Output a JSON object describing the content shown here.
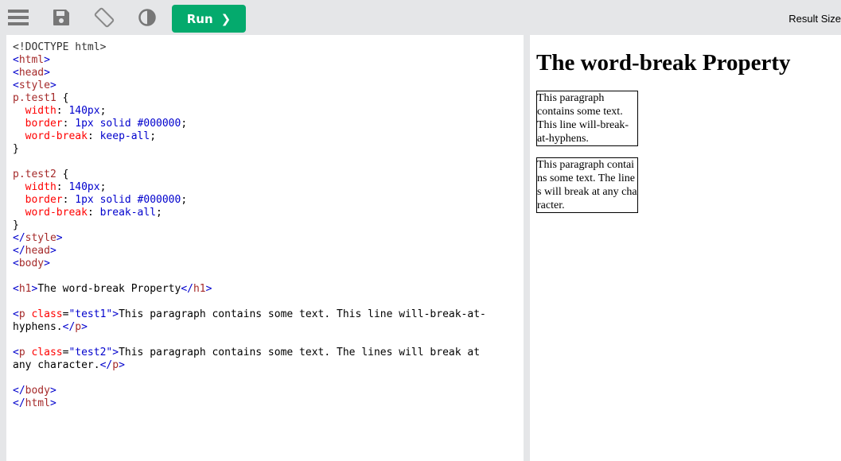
{
  "toolbar": {
    "icons": [
      "menu-icon",
      "save-icon",
      "rotate-icon",
      "contrast-icon"
    ],
    "run_label": "Run",
    "run_chevron": "❯",
    "result_size_label": "Result Size"
  },
  "editor": {
    "lines": [
      [
        {
          "c": "doc",
          "t": "<!DOCTYPE html>"
        }
      ],
      [
        {
          "c": "bl",
          "t": "<"
        },
        {
          "c": "tag",
          "t": "html"
        },
        {
          "c": "bl",
          "t": ">"
        }
      ],
      [
        {
          "c": "bl",
          "t": "<"
        },
        {
          "c": "tag",
          "t": "head"
        },
        {
          "c": "bl",
          "t": ">"
        }
      ],
      [
        {
          "c": "bl",
          "t": "<"
        },
        {
          "c": "tag",
          "t": "style"
        },
        {
          "c": "bl",
          "t": ">"
        }
      ],
      [
        {
          "c": "sel",
          "t": "p.test1"
        },
        {
          "c": "txt",
          "t": " {"
        }
      ],
      [
        {
          "c": "txt",
          "t": "  "
        },
        {
          "c": "prop",
          "t": "width"
        },
        {
          "c": "txt",
          "t": ": "
        },
        {
          "c": "val",
          "t": "140px"
        },
        {
          "c": "txt",
          "t": ";"
        }
      ],
      [
        {
          "c": "txt",
          "t": "  "
        },
        {
          "c": "prop",
          "t": "border"
        },
        {
          "c": "txt",
          "t": ": "
        },
        {
          "c": "val",
          "t": "1px solid #000000"
        },
        {
          "c": "txt",
          "t": ";"
        }
      ],
      [
        {
          "c": "txt",
          "t": "  "
        },
        {
          "c": "prop",
          "t": "word-break"
        },
        {
          "c": "txt",
          "t": ": "
        },
        {
          "c": "val",
          "t": "keep-all"
        },
        {
          "c": "txt",
          "t": ";"
        }
      ],
      [
        {
          "c": "txt",
          "t": "}"
        }
      ],
      [],
      [
        {
          "c": "sel",
          "t": "p.test2"
        },
        {
          "c": "txt",
          "t": " {"
        }
      ],
      [
        {
          "c": "txt",
          "t": "  "
        },
        {
          "c": "prop",
          "t": "width"
        },
        {
          "c": "txt",
          "t": ": "
        },
        {
          "c": "val",
          "t": "140px"
        },
        {
          "c": "txt",
          "t": ";"
        }
      ],
      [
        {
          "c": "txt",
          "t": "  "
        },
        {
          "c": "prop",
          "t": "border"
        },
        {
          "c": "txt",
          "t": ": "
        },
        {
          "c": "val",
          "t": "1px solid #000000"
        },
        {
          "c": "txt",
          "t": ";"
        }
      ],
      [
        {
          "c": "txt",
          "t": "  "
        },
        {
          "c": "prop",
          "t": "word-break"
        },
        {
          "c": "txt",
          "t": ": "
        },
        {
          "c": "val",
          "t": "break-all"
        },
        {
          "c": "txt",
          "t": ";"
        }
      ],
      [
        {
          "c": "txt",
          "t": "}"
        }
      ],
      [
        {
          "c": "bl",
          "t": "</"
        },
        {
          "c": "tag",
          "t": "style"
        },
        {
          "c": "bl",
          "t": ">"
        }
      ],
      [
        {
          "c": "bl",
          "t": "</"
        },
        {
          "c": "tag",
          "t": "head"
        },
        {
          "c": "bl",
          "t": ">"
        }
      ],
      [
        {
          "c": "bl",
          "t": "<"
        },
        {
          "c": "tag",
          "t": "body"
        },
        {
          "c": "bl",
          "t": ">"
        }
      ],
      [],
      [
        {
          "c": "bl",
          "t": "<"
        },
        {
          "c": "tag",
          "t": "h1"
        },
        {
          "c": "bl",
          "t": ">"
        },
        {
          "c": "txt",
          "t": "The word-break Property"
        },
        {
          "c": "bl",
          "t": "</"
        },
        {
          "c": "tag",
          "t": "h1"
        },
        {
          "c": "bl",
          "t": ">"
        }
      ],
      [],
      [
        {
          "c": "bl",
          "t": "<"
        },
        {
          "c": "tag",
          "t": "p"
        },
        {
          "c": "attr",
          "t": " class"
        },
        {
          "c": "txt",
          "t": "="
        },
        {
          "c": "val",
          "t": "\"test1\""
        },
        {
          "c": "bl",
          "t": ">"
        },
        {
          "c": "txt",
          "t": "This paragraph contains some text. This line will-break-at-"
        }
      ],
      [
        {
          "c": "txt",
          "t": "hyphens."
        },
        {
          "c": "bl",
          "t": "</"
        },
        {
          "c": "tag",
          "t": "p"
        },
        {
          "c": "bl",
          "t": ">"
        }
      ],
      [],
      [
        {
          "c": "bl",
          "t": "<"
        },
        {
          "c": "tag",
          "t": "p"
        },
        {
          "c": "attr",
          "t": " class"
        },
        {
          "c": "txt",
          "t": "="
        },
        {
          "c": "val",
          "t": "\"test2\""
        },
        {
          "c": "bl",
          "t": ">"
        },
        {
          "c": "txt",
          "t": "This paragraph contains some text. The lines will break at"
        }
      ],
      [
        {
          "c": "txt",
          "t": "any character."
        },
        {
          "c": "bl",
          "t": "</"
        },
        {
          "c": "tag",
          "t": "p"
        },
        {
          "c": "bl",
          "t": ">"
        }
      ],
      [],
      [
        {
          "c": "bl",
          "t": "</"
        },
        {
          "c": "tag",
          "t": "body"
        },
        {
          "c": "bl",
          "t": ">"
        }
      ],
      [
        {
          "c": "bl",
          "t": "</"
        },
        {
          "c": "tag",
          "t": "html"
        },
        {
          "c": "bl",
          "t": ">"
        }
      ]
    ]
  },
  "result": {
    "heading": "The word-break Property",
    "test1_text": "This paragraph contains some text. This line will-break-at-hyphens.",
    "test2_text": "This paragraph contains some text. The lines will break at any character."
  },
  "colors": {
    "run_button": "#04aa6d",
    "toolbar_bg": "#e5e6e8",
    "tag": "#a52a2a",
    "bracket": "#0000cd",
    "property": "#ff0000"
  }
}
